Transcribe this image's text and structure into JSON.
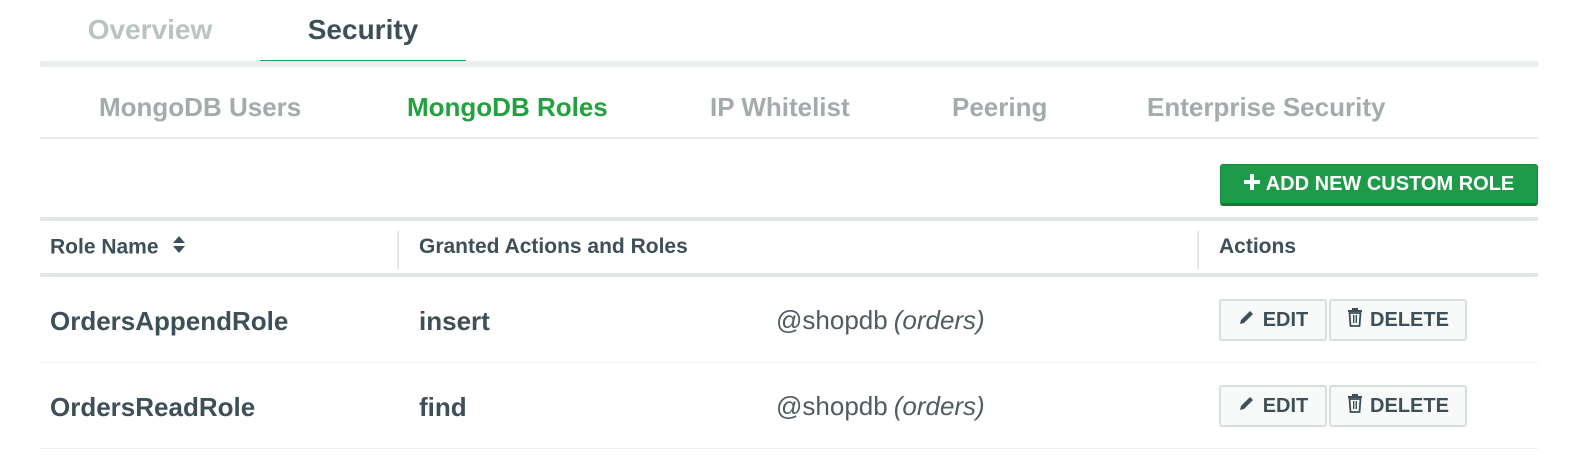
{
  "top_tabs": [
    {
      "label": "Overview",
      "active": false
    },
    {
      "label": "Security",
      "active": true
    }
  ],
  "sub_tabs": [
    {
      "label": "MongoDB Users",
      "active": false
    },
    {
      "label": "MongoDB Roles",
      "active": true
    },
    {
      "label": "IP Whitelist",
      "active": false
    },
    {
      "label": "Peering",
      "active": false
    },
    {
      "label": "Enterprise Security",
      "active": false
    }
  ],
  "add_button": {
    "icon": "plus-icon",
    "label": "ADD NEW CUSTOM ROLE"
  },
  "table": {
    "headers": {
      "role_name": "Role Name",
      "granted": "Granted Actions and Roles",
      "actions": "Actions"
    },
    "sort_icon": "sort-icon",
    "rows": [
      {
        "role_name": "OrdersAppendRole",
        "action": "insert",
        "database": "@shopdb",
        "collection": "(orders)",
        "edit_label": "EDIT",
        "delete_label": "DELETE"
      },
      {
        "role_name": "OrdersReadRole",
        "action": "find",
        "database": "@shopdb",
        "collection": "(orders)",
        "edit_label": "EDIT",
        "delete_label": "DELETE"
      }
    ]
  },
  "colors": {
    "accent": "#13aa52",
    "button_green": "#1d9b49",
    "text": "#3d4f58",
    "muted": "#a3acac"
  }
}
